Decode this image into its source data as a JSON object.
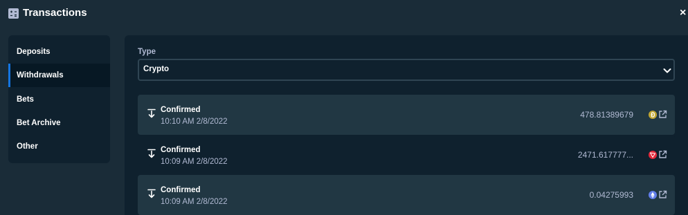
{
  "header": {
    "title": "Transactions",
    "icon": "transactions-icon",
    "close_label": "×"
  },
  "sidebar": {
    "items": [
      {
        "label": "Deposits",
        "active": false
      },
      {
        "label": "Withdrawals",
        "active": true
      },
      {
        "label": "Bets",
        "active": false
      },
      {
        "label": "Bet Archive",
        "active": false
      },
      {
        "label": "Other",
        "active": false
      }
    ]
  },
  "filter": {
    "label": "Type",
    "selected": "Crypto"
  },
  "transactions": [
    {
      "status": "Confirmed",
      "time": "10:10 AM 2/8/2022",
      "amount": "478.81389679",
      "coin_icon": "dogecoin-icon",
      "coin_color": "#c2a633"
    },
    {
      "status": "Confirmed",
      "time": "10:09 AM 2/8/2022",
      "amount": "2471.617777...",
      "coin_icon": "tron-icon",
      "coin_color": "#e3283a"
    },
    {
      "status": "Confirmed",
      "time": "10:09 AM 2/8/2022",
      "amount": "0.04275993",
      "coin_icon": "ethereum-icon",
      "coin_color": "#627eea"
    }
  ],
  "colors": {
    "background": "#1a2c38",
    "panel": "#0f212e",
    "row_alt": "#213743",
    "accent": "#1475e1",
    "muted_text": "#b1bad3"
  }
}
